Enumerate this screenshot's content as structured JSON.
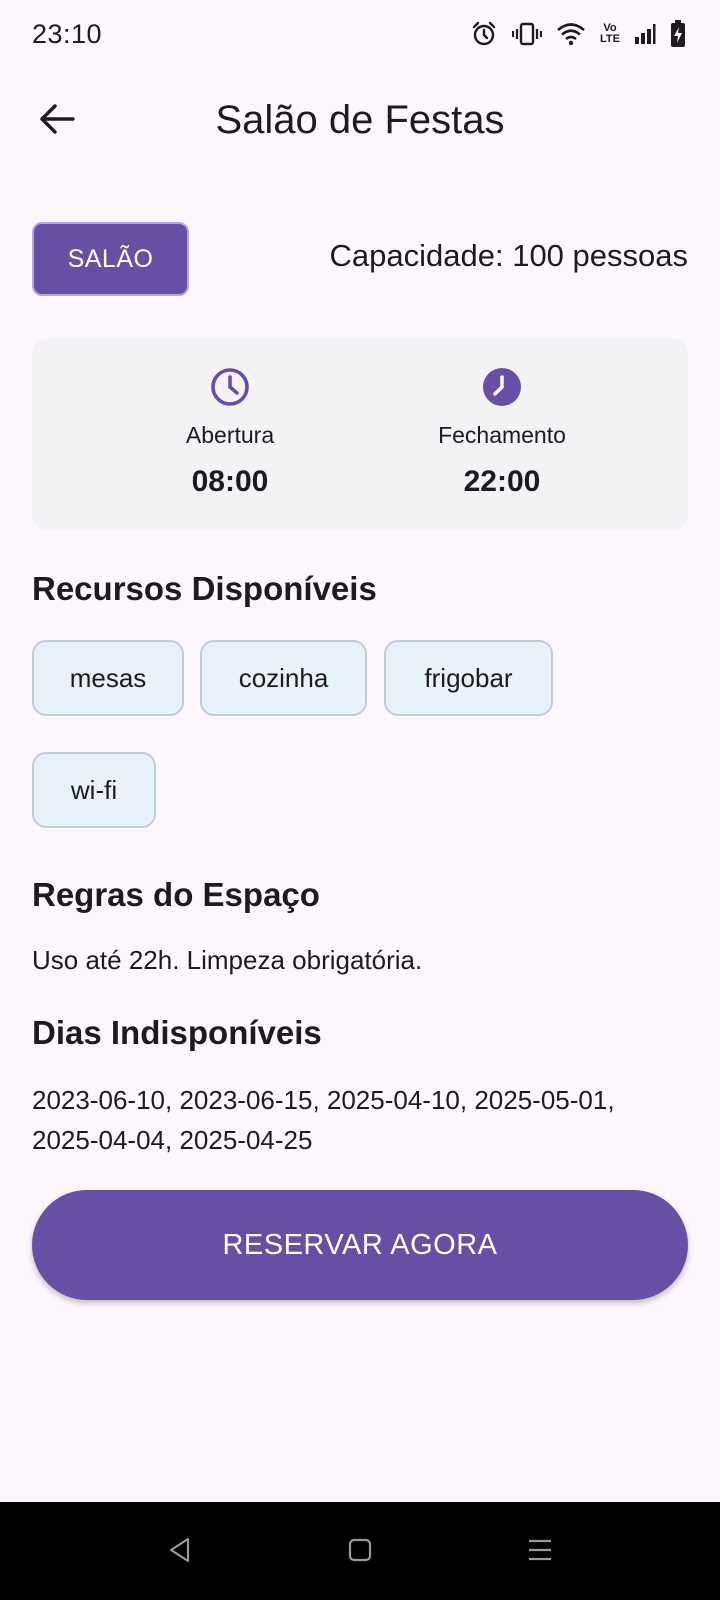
{
  "status_bar": {
    "time": "23:10",
    "icons": [
      "alarm-icon",
      "vibrate-icon",
      "wifi-icon",
      "volte-icon",
      "signal-icon",
      "battery-charging-icon"
    ],
    "volte_top": "Vo",
    "volte_bottom": "LTE"
  },
  "app_bar": {
    "back_icon": "arrow-left-icon",
    "title": "Salão de Festas"
  },
  "space": {
    "type_label": "SALÃO",
    "capacity": "Capacidade: 100 pessoas"
  },
  "hours": {
    "open_label": "Abertura",
    "open_value": "08:00",
    "open_icon": "clock-outline-icon",
    "close_label": "Fechamento",
    "close_value": "22:00",
    "close_icon": "clock-filled-icon"
  },
  "resources": {
    "title": "Recursos Disponíveis",
    "items": [
      "mesas",
      "cozinha",
      "frigobar",
      "wi-fi"
    ]
  },
  "rules": {
    "title": "Regras do Espaço",
    "text": "Uso até 22h. Limpeza obrigatória."
  },
  "unavailable": {
    "title": "Dias Indisponíveis",
    "text": "2023-06-10, 2023-06-15, 2025-04-10, 2025-05-01, 2025-04-04, 2025-04-25"
  },
  "cta": {
    "label": "RESERVAR AGORA"
  },
  "nav_bar": {
    "icons": [
      "nav-back-icon",
      "nav-home-icon",
      "nav-recents-icon"
    ]
  },
  "colors": {
    "primary": "#6750a4",
    "background": "#fdf7fd",
    "card": "#f3f2f5",
    "chip": "#e7f2fd"
  }
}
